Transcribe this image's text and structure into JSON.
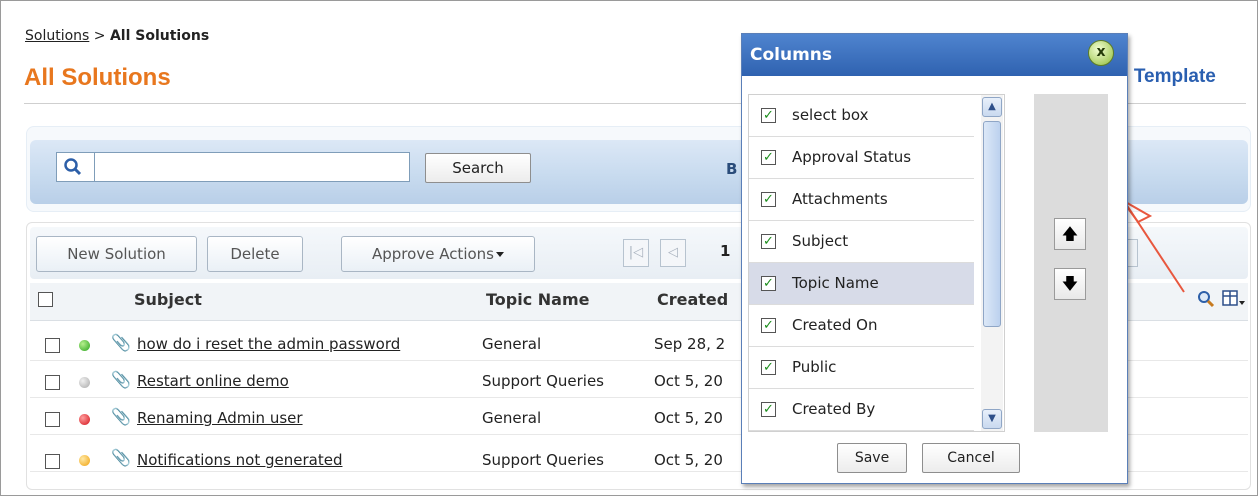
{
  "breadcrumb": {
    "parent": "Solutions",
    "separator": ">",
    "current": "All Solutions"
  },
  "page": {
    "title": "All Solutions",
    "right_link": "s Template"
  },
  "search": {
    "value": "",
    "button": "Search",
    "partial_label": "B"
  },
  "toolbar": {
    "new": "New Solution",
    "delete": "Delete",
    "approve": "Approve Actions",
    "page": "1"
  },
  "table": {
    "headers": [
      "Subject",
      "Topic Name",
      "Created"
    ],
    "rows": [
      {
        "status": "green",
        "attachment": "faint",
        "subject": "how do i reset the admin password",
        "topic": "General",
        "created": "Sep 28, 2"
      },
      {
        "status": "gray",
        "attachment": "dark",
        "subject": "Restart online demo ",
        "topic": "Support Queries",
        "created": "Oct 5, 20"
      },
      {
        "status": "red",
        "attachment": "dark",
        "subject": "Renaming Admin user ",
        "topic": "General",
        "created": "Oct 5, 20"
      },
      {
        "status": "yellow",
        "attachment": "dark",
        "subject": "Notifications not generated ",
        "topic": "Support Queries",
        "created": "Oct 5, 20"
      }
    ]
  },
  "dialog": {
    "title": "Columns",
    "close": "x",
    "items": [
      {
        "label": "select box",
        "checked": true
      },
      {
        "label": "Approval Status",
        "checked": true
      },
      {
        "label": "Attachments",
        "checked": true
      },
      {
        "label": "Subject",
        "checked": true
      },
      {
        "label": "Topic Name",
        "checked": true,
        "selected": true
      },
      {
        "label": "Created On",
        "checked": true
      },
      {
        "label": "Public",
        "checked": true
      },
      {
        "label": "Created By",
        "checked": true
      }
    ],
    "save": "Save",
    "cancel": "Cancel"
  },
  "colors": {
    "title": "#e8771e",
    "link_blue": "#2a5fb0",
    "dialog_header": "#2f62b0",
    "annotation_arrow": "#e8573e"
  }
}
